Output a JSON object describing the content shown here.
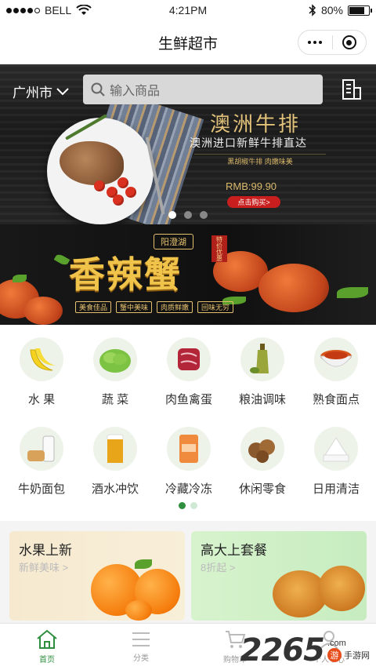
{
  "status_bar": {
    "carrier": "BELL",
    "time": "4:21PM",
    "battery": "80%"
  },
  "nav": {
    "title": "生鲜超市"
  },
  "hero": {
    "city": "广州市",
    "search_placeholder": "输入商品",
    "promo_title": "澳洲牛排",
    "promo_subtitle": "澳洲进口新鲜牛排直达",
    "promo_line": "黑胡椒牛排 肉嫩味美",
    "price": "RMB:99.90",
    "buy_button": "点击购买>",
    "slides": 3,
    "active_slide": 0
  },
  "crab_banner": {
    "tag_top": "阳澄湖",
    "tag_red": "特价优惠",
    "headline": "香辣蟹",
    "slogans": [
      "美食佳品",
      "蟹中美味",
      "肉质鲜嫩",
      "回味无穷"
    ]
  },
  "categories": [
    {
      "label": "水 果",
      "icon": "banana-icon"
    },
    {
      "label": "蔬 菜",
      "icon": "lettuce-icon"
    },
    {
      "label": "肉鱼禽蛋",
      "icon": "meat-icon"
    },
    {
      "label": "粮油调味",
      "icon": "oil-bottle-icon"
    },
    {
      "label": "熟食面点",
      "icon": "noodle-bowl-icon"
    },
    {
      "label": "牛奶面包",
      "icon": "milk-bread-icon"
    },
    {
      "label": "酒水冲饮",
      "icon": "beer-icon"
    },
    {
      "label": "冷藏冷冻",
      "icon": "frozen-fish-icon"
    },
    {
      "label": "休闲零食",
      "icon": "cookies-icon"
    },
    {
      "label": "日用清洁",
      "icon": "tissue-icon"
    }
  ],
  "category_pages": {
    "count": 2,
    "active": 0
  },
  "cards": [
    {
      "title": "水果上新",
      "subtitle": "新鲜美味 >"
    },
    {
      "title": "高大上套餐",
      "subtitle": "8折起 >"
    }
  ],
  "tabs": [
    {
      "label": "首页",
      "icon": "home-icon",
      "active": true
    },
    {
      "label": "分类",
      "icon": "list-icon",
      "active": false
    },
    {
      "label": "购物车",
      "icon": "cart-icon",
      "active": false
    },
    {
      "label": "个人中心",
      "icon": "user-icon",
      "active": false
    }
  ],
  "watermark": {
    "number": "2265",
    "suffix": ".com",
    "site": "手游网"
  },
  "colors": {
    "accent": "#2f8f3f",
    "gold": "#e3c27a",
    "red": "#c81e1e"
  }
}
